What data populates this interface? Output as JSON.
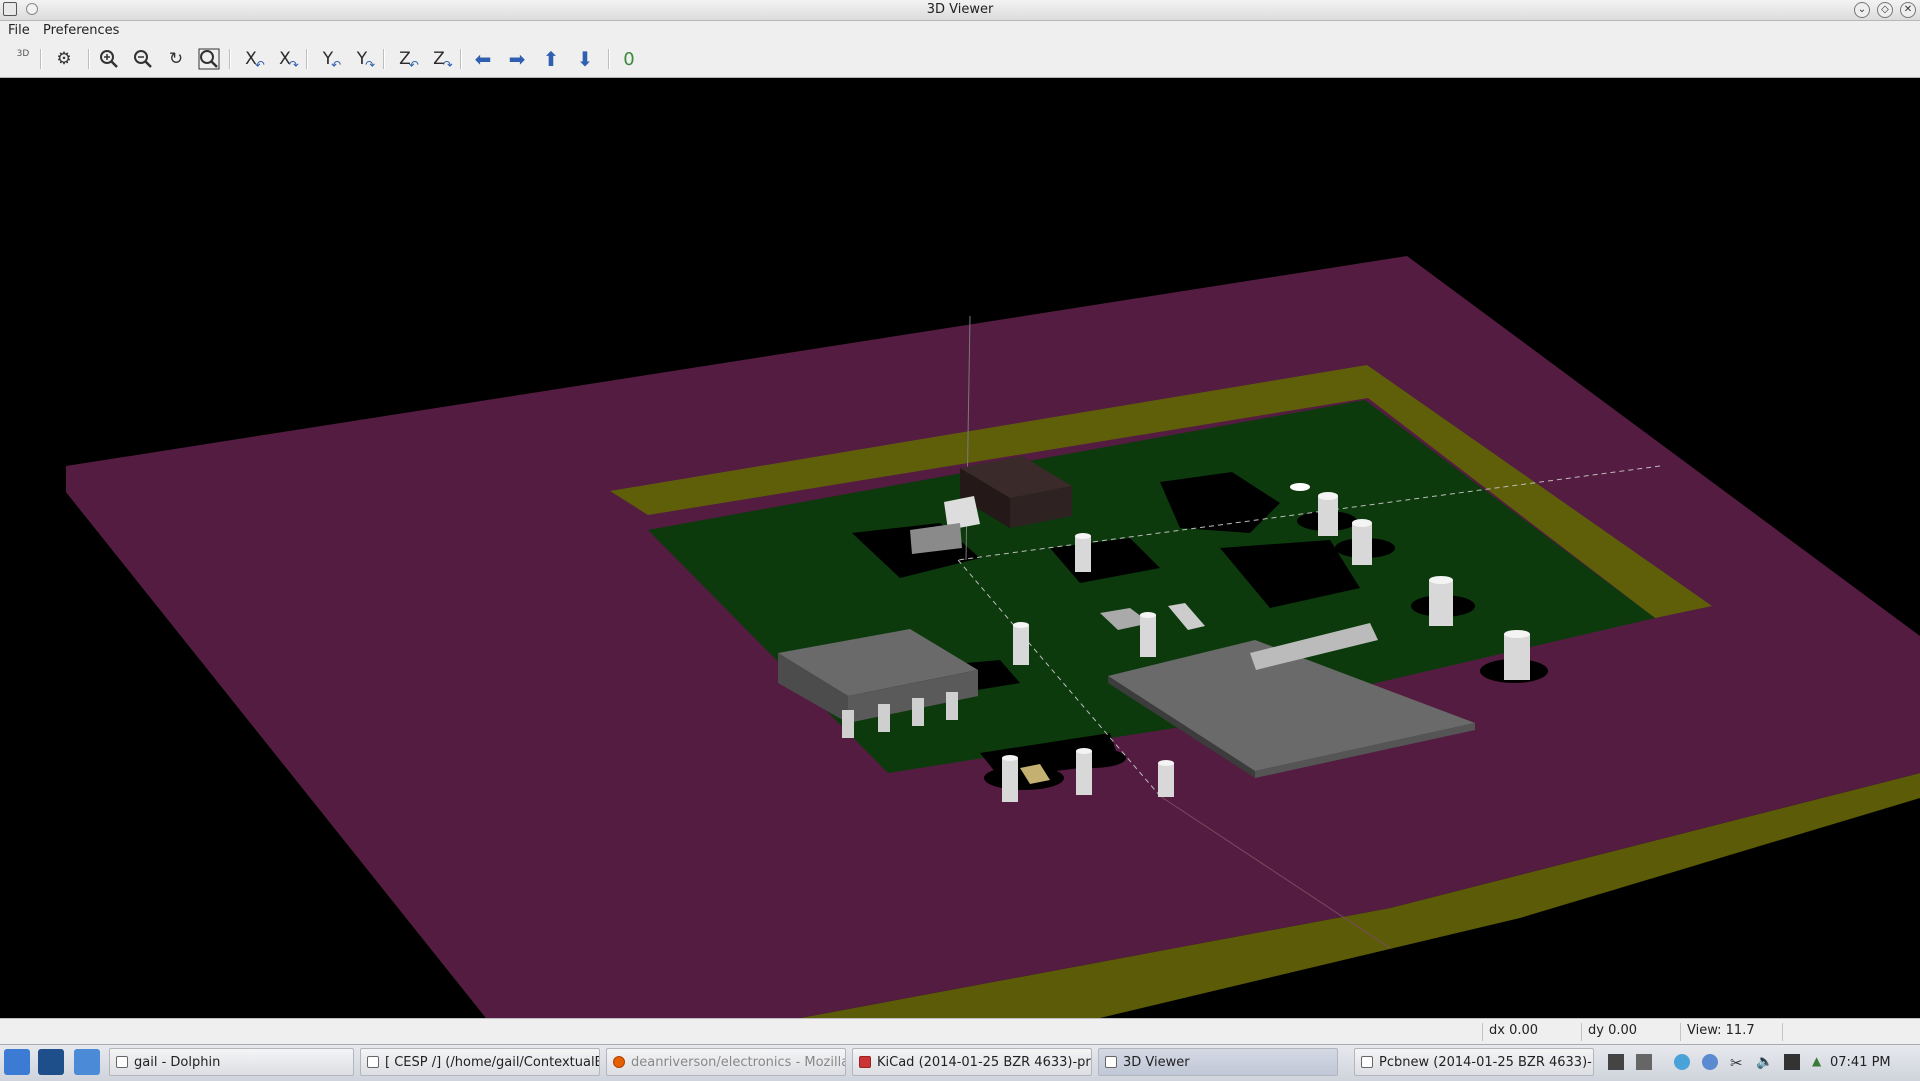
{
  "window": {
    "title": "3D Viewer"
  },
  "menu": {
    "file": "File",
    "preferences": "Preferences"
  },
  "toolbar": {
    "logo_text": "3D",
    "rotate_x_left": "X",
    "rotate_x_right": "X",
    "rotate_y_left": "Y",
    "rotate_y_right": "Y",
    "rotate_z_left": "Z",
    "rotate_z_right": "Z",
    "ortho_label": "0"
  },
  "status": {
    "dx": "dx 0.00",
    "dy": "dy 0.00",
    "view": "View: 11.7"
  },
  "taskbar": {
    "tasks": [
      {
        "label": "gail - Dolphin"
      },
      {
        "label": "[ CESP /] (/home/gail/ContextualEl"
      },
      {
        "label": "deanriverson/electronics - Mozilla F"
      },
      {
        "label": "KiCad (2014-01-25 BZR 4633)-prod"
      },
      {
        "label": "3D Viewer"
      },
      {
        "label": "Pcbnew (2014-01-25 BZR 4633)-prc"
      }
    ],
    "clock": "07:41 PM"
  },
  "colors": {
    "frame_top": "#541c40",
    "frame_edge": "#5b5b08",
    "pcb_solder": "#0c3a0c",
    "pcb_copper": "#000000",
    "component_gray": "#5a5a5a",
    "ic_body": "#2b2222"
  }
}
